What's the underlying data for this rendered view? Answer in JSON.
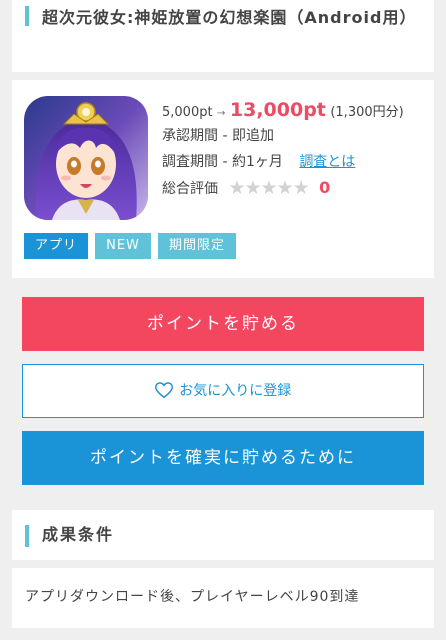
{
  "title": {
    "text": "超次元彼女:神姫放置の幻想楽園（Android用）"
  },
  "offer": {
    "app_icon": "anime-girl-app-icon",
    "points_before": "5,000pt",
    "arrow": "→",
    "points_after": "13,000pt",
    "yen_value": "(1,300円分)",
    "approval_period": "承認期間 - 即追加",
    "survey_period": "調査期間 - 約1ヶ月",
    "survey_link": "調査とは",
    "rating_label": "総合評価",
    "rating_stars": "★★★★★",
    "rating_value": "0",
    "tags": [
      "アプリ",
      "NEW",
      "期間限定"
    ]
  },
  "buttons": {
    "save_points": "ポイントを貯める",
    "favorite": "お気に入りに登録",
    "sure_points": "ポイントを確実に貯めるために"
  },
  "conditions": {
    "title": "成果条件",
    "text": "アプリダウンロード後、プレイヤーレベル90到達"
  },
  "colors": {
    "accent_blue": "#1a94d6",
    "accent_cyan": "#5fc2d8",
    "accent_red": "#f34760",
    "background": "#efefef"
  }
}
